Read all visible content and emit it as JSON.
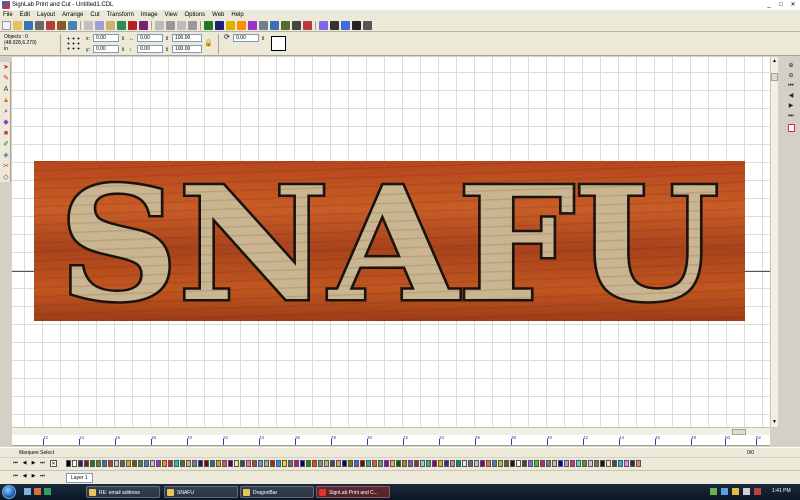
{
  "window": {
    "title": "SignLab Print and Cut - Untitled1.CDL",
    "minimize": "_",
    "restore": "□",
    "close": "✕"
  },
  "menu": [
    "File",
    "Edit",
    "Layout",
    "Arrange",
    "Cut",
    "Transform",
    "Image",
    "View",
    "Options",
    "Web",
    "Help"
  ],
  "properties": {
    "objects_label": "Objects : 0",
    "coordinates": "(48.028,6.279)",
    "units": "in",
    "x_label": "x:",
    "x_value": "0.00",
    "y_label": "y:",
    "y_value": "0.00",
    "width_value": "0.00",
    "height_value": "0.00",
    "scale_x": "100.00",
    "scale_y": "100.00",
    "angle": "0.00"
  },
  "canvas": {
    "sign_text": "SNAFU",
    "sign_colors": {
      "wood": "#b4471c",
      "letter_fill": "#c9b58f",
      "letter_outline": "#1a1410"
    }
  },
  "ruler": {
    "ticks": [
      "12",
      "14",
      "16",
      "18",
      "20",
      "22",
      "24",
      "26",
      "28",
      "30",
      "32",
      "34",
      "36",
      "38",
      "40",
      "42",
      "44",
      "46",
      "48",
      "50",
      "52"
    ]
  },
  "status": {
    "tool_hint": "Marquee Select",
    "page": "0/0"
  },
  "palette": {
    "colors": [
      "#000000",
      "#ffffff",
      "#1f1f7a",
      "#7a1f1f",
      "#1f7a1f",
      "#7a7a1f",
      "#3b6fb6",
      "#b63b3b",
      "#c8c8c8",
      "#606060",
      "#e0b000",
      "#8b4513",
      "#2e8b57",
      "#4682b4",
      "#b0c4de",
      "#9932cc",
      "#ff8c00",
      "#dc143c",
      "#00ced1",
      "#556b2f",
      "#d2b48c",
      "#708090",
      "#191970",
      "#800000",
      "#008080",
      "#daa520",
      "#cd5c5c",
      "#4b0082",
      "#f0e68c",
      "#2f4f4f",
      "#ff69b4",
      "#a0522d",
      "#6495ed",
      "#8fbc8f",
      "#b22222",
      "#1e90ff",
      "#ffd700",
      "#696969",
      "#c71585",
      "#00008b",
      "#228b22",
      "#ff4500",
      "#5f9ea0",
      "#bdb76b",
      "#483d8b",
      "#e9967a",
      "#000080",
      "#808000",
      "#4169e1",
      "#8b0000",
      "#20b2aa",
      "#d2691e",
      "#778899",
      "#9400d3",
      "#f4a460",
      "#006400",
      "#b8860b",
      "#6a5acd",
      "#a52a2a",
      "#87ceeb",
      "#3cb371",
      "#8b008b",
      "#ffa500",
      "#2f2f8f",
      "#bc8f8f",
      "#008b8b",
      "#e6e6fa",
      "#556b8f",
      "#c0c0c0",
      "#800080",
      "#ff6347",
      "#4682b4",
      "#9acd32",
      "#8b4726",
      "#1c1c1c",
      "#f5f5dc",
      "#483d3d",
      "#7b68ee",
      "#32cd32",
      "#b03060",
      "#708090",
      "#deb887",
      "#0000cd",
      "#a9a9a9",
      "#ff1493",
      "#40e0d0",
      "#6b8e23",
      "#d8bfd8",
      "#8b7355",
      "#191919",
      "#ffdab9",
      "#5c4033",
      "#00bfff",
      "#ee82ee",
      "#2e2e2e",
      "#f08080"
    ]
  },
  "layers": {
    "active": "Layer 1"
  },
  "taskbar": {
    "items": [
      "RE: email address",
      "SNAFU",
      "DragonBar",
      "SignLab Print and C..."
    ],
    "clock": "1:41 PM"
  }
}
